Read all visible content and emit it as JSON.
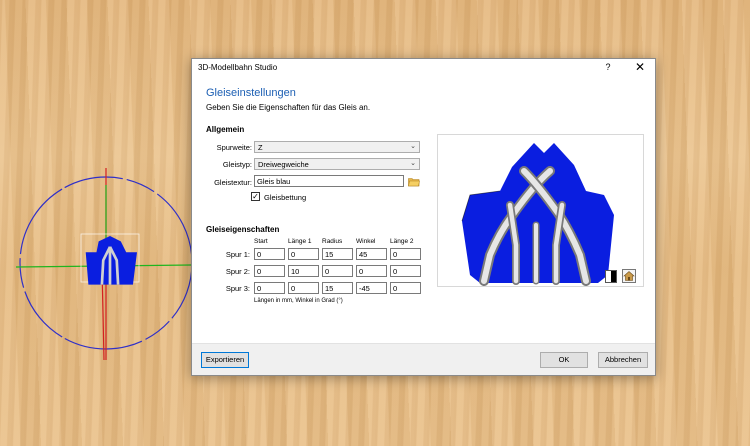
{
  "dialog": {
    "title": "3D-Modellbahn Studio",
    "help_label": "?",
    "close_label": "✕",
    "heading": "Gleiseinstellungen",
    "subheading": "Geben Sie die Eigenschaften für das Gleis an."
  },
  "general": {
    "section_title": "Allgemein",
    "spurweite_label": "Spurweite:",
    "spurweite_value": "Z",
    "gleistyp_label": "Gleistyp:",
    "gleistyp_value": "Dreiwegweiche",
    "gleistextur_label": "Gleistextur:",
    "gleistextur_value": "Gleis blau",
    "gleisbettung_label": "Gleisbettung",
    "gleisbettung_checked": true
  },
  "track_properties": {
    "section_title": "Gleiseigenschaften",
    "columns": [
      "Start",
      "Länge 1",
      "Radius",
      "Winkel",
      "Länge 2"
    ],
    "rows": [
      {
        "label": "Spur 1:",
        "values": [
          "0",
          "0",
          "15",
          "45",
          "0"
        ]
      },
      {
        "label": "Spur 2:",
        "values": [
          "0",
          "10",
          "0",
          "0",
          "0"
        ]
      },
      {
        "label": "Spur 3:",
        "values": [
          "0",
          "0",
          "15",
          "-45",
          "0"
        ]
      }
    ],
    "note": "Längen in mm, Winkel in Grad (°)"
  },
  "footer": {
    "export_label": "Exportieren",
    "ok_label": "OK",
    "cancel_label": "Abbrechen"
  },
  "icons": {
    "folder": "folder-icon",
    "chevron": "chevron-down-icon",
    "close": "close-icon"
  },
  "colors": {
    "track_blue": "#0a1ee0",
    "heading_blue": "#1c5fb3",
    "axis_red": "#d42020",
    "axis_green": "#1fb51f",
    "circle_blue": "#3030c8"
  }
}
